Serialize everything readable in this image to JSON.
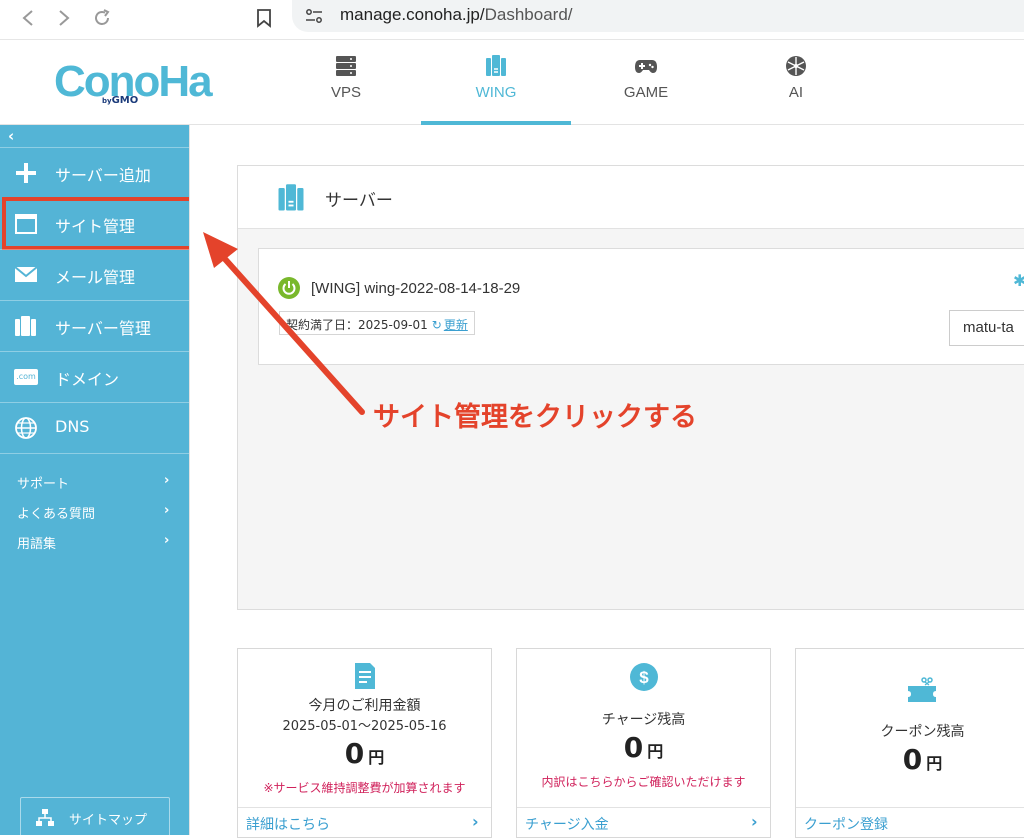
{
  "browser": {
    "url_host": "manage.conoha.jp/",
    "url_path": "Dashboard/"
  },
  "logo": {
    "text": "ConoHa",
    "sub_by": "by",
    "sub_brand": "GMO"
  },
  "tabs": [
    {
      "label": "VPS",
      "icon": "server-rack-icon"
    },
    {
      "label": "WING",
      "icon": "wing-server-icon",
      "active": true
    },
    {
      "label": "GAME",
      "icon": "gamepad-icon"
    },
    {
      "label": "AI",
      "icon": "ai-chip-icon"
    }
  ],
  "sidebar": {
    "collapse": "‹",
    "items": [
      {
        "label": "サーバー追加",
        "icon": "plus-icon"
      },
      {
        "label": "サイト管理",
        "icon": "browser-window-icon"
      },
      {
        "label": "メール管理",
        "icon": "mail-icon"
      },
      {
        "label": "サーバー管理",
        "icon": "server-icon"
      },
      {
        "label": "ドメイン",
        "icon": "domain-com-icon",
        "icon_text": ".com"
      },
      {
        "label": "DNS",
        "icon": "globe-icon"
      }
    ],
    "links": [
      {
        "label": "サポート",
        "chevron": "›"
      },
      {
        "label": "よくある質問",
        "chevron": "›"
      },
      {
        "label": "用語集",
        "chevron": "›"
      }
    ],
    "sitemap": "サイトマップ"
  },
  "server": {
    "title": "サーバー",
    "name": "[WING] wing-2022-08-14-18-29",
    "contract_label": "契約満了日：2025-09-01",
    "renew": "更新",
    "domain": "matu-ta"
  },
  "annotation": "サイト管理をクリックする",
  "billing": [
    {
      "title": "今月のご利用金額",
      "period": "2025-05-01～2025-05-16",
      "amount": "0",
      "unit": "円",
      "note": "※サービス維持調整費が加算されます",
      "footer": "詳細はこちら"
    },
    {
      "title": "チャージ残高",
      "amount": "0",
      "unit": "円",
      "note": "内訳はこちらからご確認いただけます",
      "footer": "チャージ入金"
    },
    {
      "title": "クーポン残高",
      "amount": "0",
      "unit": "円",
      "footer": "クーポン登録"
    }
  ],
  "colors": {
    "accent": "#54b4d6",
    "annotation": "#e4432b",
    "note": "#d0215b",
    "power": "#79b82c"
  }
}
